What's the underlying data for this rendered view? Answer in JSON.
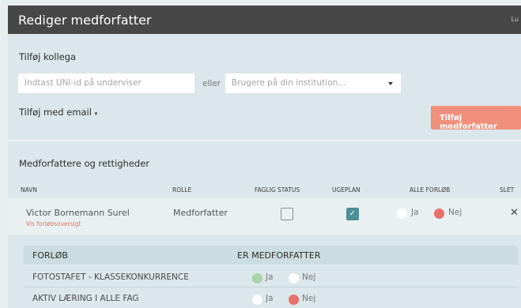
{
  "dialog": {
    "title": "Rediger medforfatter",
    "corner_text": "Lu"
  },
  "add_colleague": {
    "heading": "Tilføj kollega",
    "uni_id_placeholder": "Indtast UNI-id på underviser",
    "or_label": "eller",
    "institution_select_placeholder": "Brugere på din institution...",
    "add_by_email_label": "Tilføj med email",
    "add_button_label": "Tilføj medforfatter"
  },
  "coauthors": {
    "heading": "Medforfattere og rettigheder",
    "columns": [
      "NAVN",
      "ROLLE",
      "FAGLIG STATUS",
      "UGEPLAN",
      "ALLE FORLØB",
      "SLET"
    ],
    "rows": [
      {
        "name": "Victor Bornemann Surel",
        "link": "Vis forløbsoversigt",
        "role": "Medforfatter",
        "faglig_status": false,
        "ugeplan": true,
        "alle_forlob": "Nej",
        "yes_label": "Ja",
        "no_label": "Nej",
        "delete_symbol": "✕"
      }
    ]
  },
  "courses": {
    "columns": [
      "FORLØB",
      "ER MEDFORFATTER"
    ],
    "rows": [
      {
        "name": "FOTOSTAFET - KLASSEKONKURRENCE",
        "is_coauthor": "Ja",
        "yes_label": "Ja",
        "no_label": "Nej"
      },
      {
        "name": "AKTIV LÆRING I ALLE FAG",
        "is_coauthor": "Nej",
        "yes_label": "Ja",
        "no_label": "Nej"
      }
    ]
  },
  "colors": {
    "title_bar": "#474747",
    "accent_button": "#ef8f7c",
    "checkbox_checked": "#4c8f95",
    "radio_no_selected": "#e8706a",
    "radio_yes_selected": "#a9d3a9"
  }
}
